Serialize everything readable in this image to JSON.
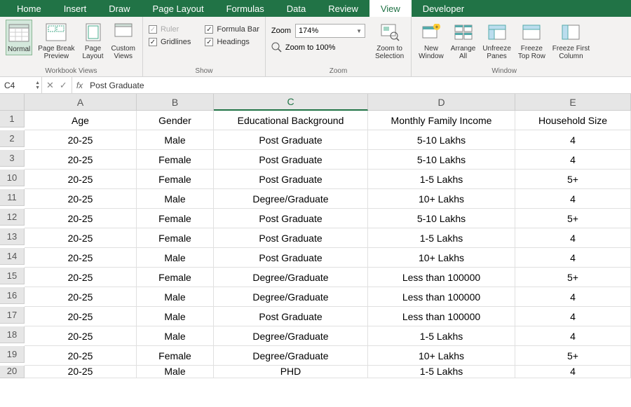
{
  "tabs": [
    "Home",
    "Insert",
    "Draw",
    "Page Layout",
    "Formulas",
    "Data",
    "Review",
    "View",
    "Developer"
  ],
  "activeTab": "View",
  "groups": {
    "workbookViews": {
      "label": "Workbook Views",
      "normal": "Normal",
      "pageBreak": "Page Break\nPreview",
      "pageLayout": "Page\nLayout",
      "custom": "Custom\nViews"
    },
    "show": {
      "label": "Show",
      "ruler": "Ruler",
      "formulaBar": "Formula Bar",
      "gridlines": "Gridlines",
      "headings": "Headings"
    },
    "zoom": {
      "label": "Zoom",
      "zoomLabel": "Zoom",
      "zoomValue": "174%",
      "zoom100": "Zoom to 100%",
      "zoomSel": "Zoom to\nSelection"
    },
    "window": {
      "label": "Window",
      "newWin": "New\nWindow",
      "arrange": "Arrange\nAll",
      "unfreeze": "Unfreeze\nPanes",
      "freezeTop": "Freeze\nTop Row",
      "freezeFirst": "Freeze First\nColumn"
    }
  },
  "formulaBar": {
    "nameBox": "C4",
    "fx": "fx",
    "value": "Post Graduate"
  },
  "columns": [
    "A",
    "B",
    "C",
    "D",
    "E"
  ],
  "selectedCol": "C",
  "rows": [
    {
      "n": "1",
      "c": [
        "Age",
        "Gender",
        "Educational Background",
        "Monthly Family Income",
        "Household Size"
      ]
    },
    {
      "n": "2",
      "c": [
        "20-25",
        "Male",
        "Post Graduate",
        "5-10 Lakhs",
        "4"
      ]
    },
    {
      "n": "3",
      "c": [
        "20-25",
        "Female",
        "Post Graduate",
        "5-10 Lakhs",
        "4"
      ]
    },
    {
      "n": "10",
      "c": [
        "20-25",
        "Female",
        "Post Graduate",
        "1-5 Lakhs",
        "5+"
      ]
    },
    {
      "n": "11",
      "c": [
        "20-25",
        "Male",
        "Degree/Graduate",
        "10+ Lakhs",
        "4"
      ]
    },
    {
      "n": "12",
      "c": [
        "20-25",
        "Female",
        "Post Graduate",
        "5-10 Lakhs",
        "5+"
      ]
    },
    {
      "n": "13",
      "c": [
        "20-25",
        "Female",
        "Post Graduate",
        "1-5 Lakhs",
        "4"
      ]
    },
    {
      "n": "14",
      "c": [
        "20-25",
        "Male",
        "Post Graduate",
        "10+ Lakhs",
        "4"
      ]
    },
    {
      "n": "15",
      "c": [
        "20-25",
        "Female",
        "Degree/Graduate",
        "Less than 100000",
        "5+"
      ]
    },
    {
      "n": "16",
      "c": [
        "20-25",
        "Male",
        "Degree/Graduate",
        "Less than 100000",
        "4"
      ]
    },
    {
      "n": "17",
      "c": [
        "20-25",
        "Male",
        "Post Graduate",
        "Less than 100000",
        "4"
      ]
    },
    {
      "n": "18",
      "c": [
        "20-25",
        "Male",
        "Degree/Graduate",
        "1-5 Lakhs",
        "4"
      ]
    },
    {
      "n": "19",
      "c": [
        "20-25",
        "Female",
        "Degree/Graduate",
        "10+ Lakhs",
        "5+"
      ]
    },
    {
      "n": "20",
      "c": [
        "20-25",
        "Male",
        "PHD",
        "1-5 Lakhs",
        "4"
      ]
    }
  ]
}
